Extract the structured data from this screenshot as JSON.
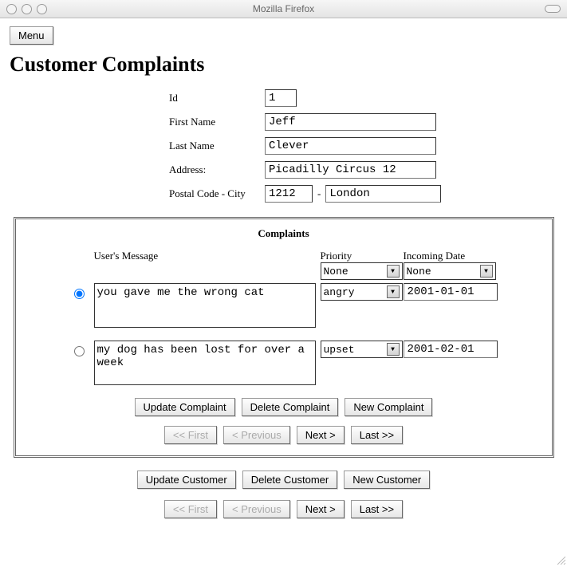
{
  "window": {
    "title": "Mozilla Firefox"
  },
  "menu": {
    "label": "Menu"
  },
  "page": {
    "heading": "Customer Complaints"
  },
  "customer": {
    "labels": {
      "id": "Id",
      "first_name": "First Name",
      "last_name": "Last Name",
      "address": "Address:",
      "postal_city": "Postal Code - City"
    },
    "id": "1",
    "first_name": "Jeff",
    "last_name": "Clever",
    "address": "Picadilly Circus 12",
    "postal_code": "1212",
    "city": "London",
    "dash": "-"
  },
  "complaints": {
    "title": "Complaints",
    "columns": {
      "message": "User's Message",
      "priority": "Priority",
      "incoming": "Incoming Date"
    },
    "priority_filter": "None",
    "date_filter": "None",
    "rows": [
      {
        "selected": true,
        "message": "you gave me the wrong cat",
        "priority": "angry",
        "date": "2001-01-01"
      },
      {
        "selected": false,
        "message": "my dog has been lost for over a week",
        "priority": "upset",
        "date": "2001-02-01"
      }
    ],
    "buttons": {
      "update": "Update Complaint",
      "delete": "Delete Complaint",
      "new": "New Complaint"
    },
    "pager": {
      "first": "<< First",
      "prev": "< Previous",
      "next": "Next >",
      "last": "Last >>"
    }
  },
  "customer_buttons": {
    "update": "Update Customer",
    "delete": "Delete Customer",
    "new": "New Customer"
  },
  "customer_pager": {
    "first": "<< First",
    "prev": "< Previous",
    "next": "Next >",
    "last": "Last >>"
  }
}
